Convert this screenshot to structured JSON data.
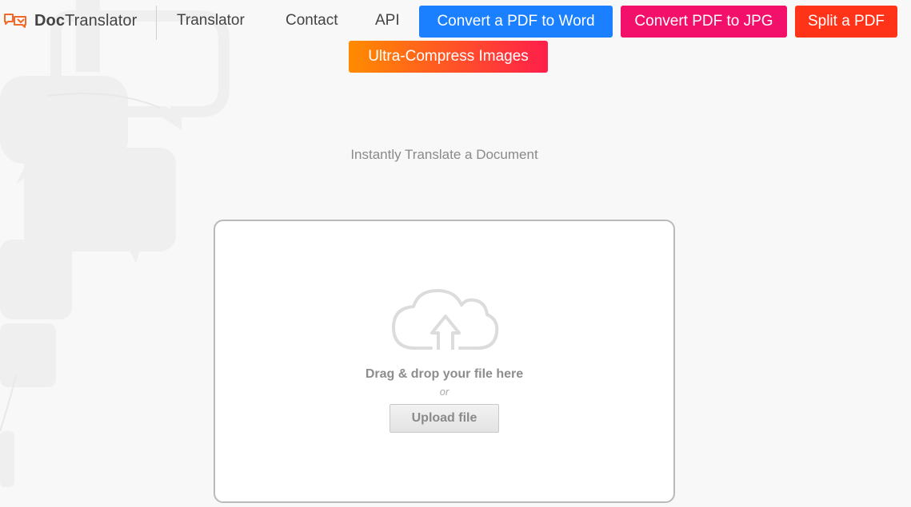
{
  "header": {
    "logo": {
      "bold": "Doc",
      "regular": "Translator",
      "icon": "speech-bubbles-icon"
    },
    "nav": [
      {
        "label": "Translator"
      },
      {
        "label": "Contact"
      },
      {
        "label": "API"
      }
    ],
    "tools": [
      {
        "label": "Convert a PDF to Word",
        "color": "#1a80ff"
      },
      {
        "label": "Convert PDF to JPG",
        "color": "#f2106a"
      },
      {
        "label": "Split a PDF",
        "color": "#ff3318"
      },
      {
        "label": "Ultra-Compress Images",
        "color_start": "#ff8c00",
        "color_end": "#ff1f4a"
      }
    ]
  },
  "main": {
    "tagline": "Instantly Translate a Document",
    "dropzone": {
      "icon": "cloud-upload-icon",
      "drag_text": "Drag & drop your file here",
      "or_text": "or",
      "upload_label": "Upload file"
    }
  },
  "colors": {
    "accent": "#f26a2a",
    "text": "#444444",
    "muted": "#8a8a8a"
  }
}
